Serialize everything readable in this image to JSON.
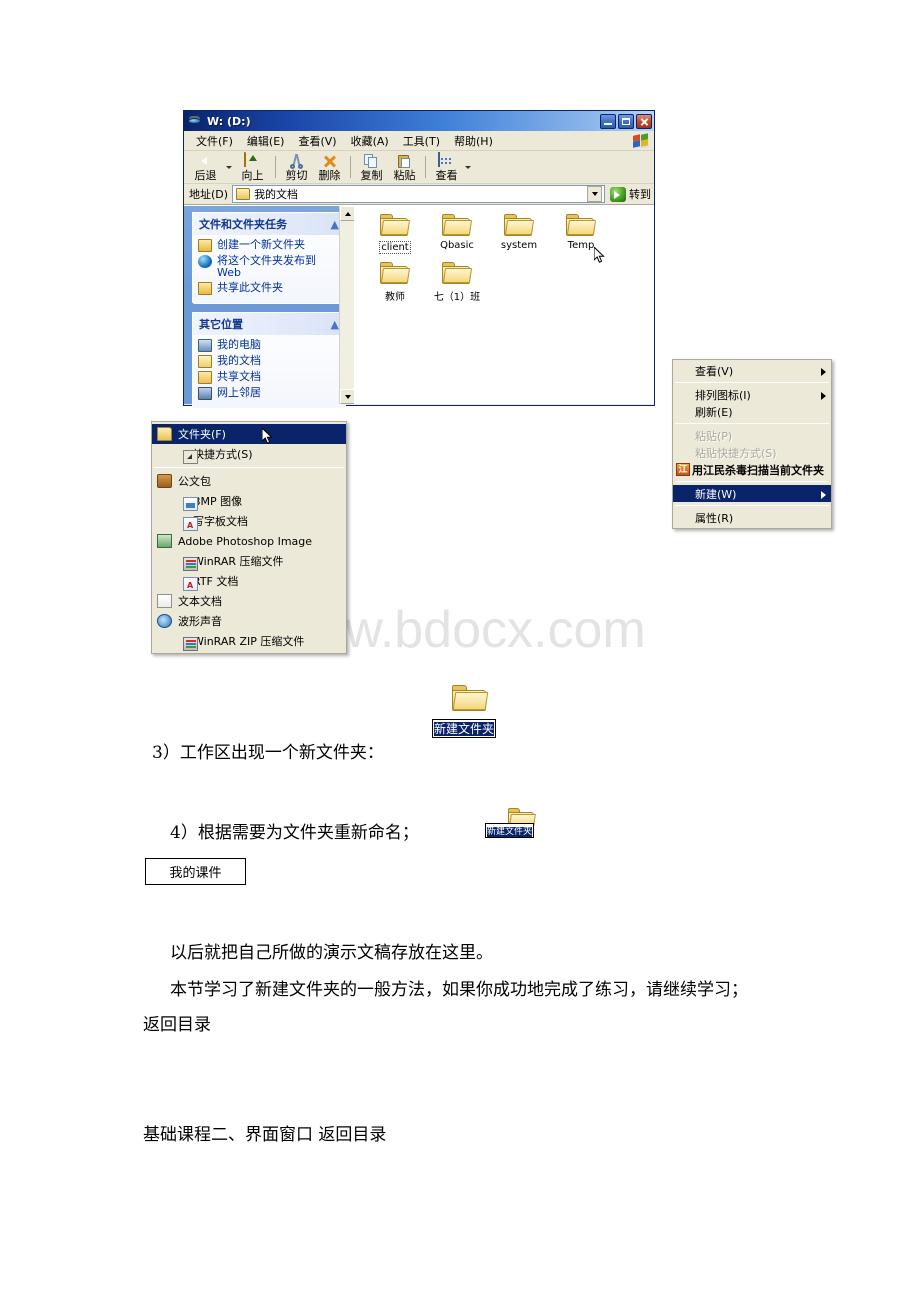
{
  "watermark": "www.bdocx.com",
  "explorer": {
    "title": "W: (D:)",
    "window_buttons": {
      "minimize": "minimize-button",
      "maximize": "maximize-button",
      "close": "close-button"
    },
    "menus": [
      "文件(F)",
      "编辑(E)",
      "查看(V)",
      "收藏(A)",
      "工具(T)",
      "帮助(H)"
    ],
    "toolbar": [
      {
        "label": "后退",
        "icon": "back-icon",
        "has_dropdown": true
      },
      {
        "label": "向上",
        "icon": "up-icon",
        "has_dropdown": false
      },
      {
        "label": "剪切",
        "icon": "cut-icon",
        "has_dropdown": false
      },
      {
        "label": "删除",
        "icon": "delete-icon",
        "has_dropdown": false
      },
      {
        "label": "复制",
        "icon": "copy-icon",
        "has_dropdown": false
      },
      {
        "label": "粘贴",
        "icon": "paste-icon",
        "has_dropdown": false
      },
      {
        "label": "查看",
        "icon": "view-icon",
        "has_dropdown": true
      }
    ],
    "address": {
      "label": "地址(D)",
      "value": "我的文档",
      "go_label": "转到"
    },
    "task_panel": {
      "title": "文件和文件夹任务",
      "items": [
        {
          "label": "创建一个新文件夹",
          "icon": "new-folder-icon"
        },
        {
          "label": "将这个文件夹发布到 Web",
          "icon": "publish-web-icon"
        },
        {
          "label": "共享此文件夹",
          "icon": "share-folder-icon"
        }
      ]
    },
    "places_panel": {
      "title": "其它位置",
      "items": [
        {
          "label": "我的电脑",
          "icon": "my-computer-icon"
        },
        {
          "label": "我的文档",
          "icon": "my-documents-icon"
        },
        {
          "label": "共享文档",
          "icon": "shared-documents-icon"
        },
        {
          "label": "网上邻居",
          "icon": "network-places-icon"
        }
      ]
    },
    "files": [
      {
        "name": "client",
        "selected": true
      },
      {
        "name": "Qbasic",
        "selected": false
      },
      {
        "name": "system",
        "selected": false
      },
      {
        "name": "Temp",
        "selected": false
      },
      {
        "name": "教师",
        "selected": false
      },
      {
        "name": "七（1）班",
        "selected": false
      }
    ]
  },
  "context_menu": {
    "items": [
      {
        "label": "查看(V)",
        "submenu": true,
        "disabled": false,
        "highlighted": false,
        "bold": false,
        "separator_after": true
      },
      {
        "label": "排列图标(I)",
        "submenu": true,
        "disabled": false,
        "highlighted": false,
        "bold": false,
        "separator_after": false
      },
      {
        "label": "刷新(E)",
        "submenu": false,
        "disabled": false,
        "highlighted": false,
        "bold": false,
        "separator_after": true
      },
      {
        "label": "粘贴(P)",
        "submenu": false,
        "disabled": true,
        "highlighted": false,
        "bold": false,
        "separator_after": false
      },
      {
        "label": "粘贴快捷方式(S)",
        "submenu": false,
        "disabled": true,
        "highlighted": false,
        "bold": false,
        "separator_after": false
      },
      {
        "label": "用江民杀毒扫描当前文件夹",
        "submenu": false,
        "disabled": false,
        "highlighted": false,
        "bold": true,
        "separator_after": true
      },
      {
        "label": "新建(W)",
        "submenu": true,
        "disabled": false,
        "highlighted": true,
        "bold": false,
        "separator_after": true
      },
      {
        "label": "属性(R)",
        "submenu": false,
        "disabled": false,
        "highlighted": false,
        "bold": false,
        "separator_after": false
      }
    ]
  },
  "submenu": {
    "items": [
      {
        "label": "文件夹(F)",
        "icon": "folder-icon",
        "highlighted": true,
        "separator_after": false
      },
      {
        "label": "快捷方式(S)",
        "icon": "shortcut-icon",
        "highlighted": false,
        "separator_after": true
      },
      {
        "label": "公文包",
        "icon": "briefcase-icon",
        "highlighted": false,
        "separator_after": false
      },
      {
        "label": "BMP 图像",
        "icon": "bmp-image-icon",
        "highlighted": false,
        "separator_after": false
      },
      {
        "label": "写字板文档",
        "icon": "wordpad-icon",
        "highlighted": false,
        "separator_after": false
      },
      {
        "label": "Adobe Photoshop Image",
        "icon": "photoshop-icon",
        "highlighted": false,
        "separator_after": false
      },
      {
        "label": "WinRAR 压缩文件",
        "icon": "winrar-icon",
        "highlighted": false,
        "separator_after": false
      },
      {
        "label": "RTF 文档",
        "icon": "rtf-icon",
        "highlighted": false,
        "separator_after": false
      },
      {
        "label": "文本文档",
        "icon": "text-file-icon",
        "highlighted": false,
        "separator_after": false
      },
      {
        "label": "波形声音",
        "icon": "wave-sound-icon",
        "highlighted": false,
        "separator_after": false
      },
      {
        "label": "WinRAR ZIP 压缩文件",
        "icon": "winrar-zip-icon",
        "highlighted": false,
        "separator_after": false
      }
    ]
  },
  "document": {
    "step3": "3）工作区出现一个新文件夹：",
    "step3_folder_name": "新建文件夹",
    "step4": "4）根据需要为文件夹重新命名；",
    "step4_folder_name": "新建文件夹",
    "renamed_label": "我的课件",
    "para1": "以后就把自己所做的演示文稿存放在这里。",
    "para2": "本节学习了新建文件夹的一般方法，如果你成功地完成了练习，请继续学习；",
    "para3": "返回目录",
    "para4": "基础课程二、界面窗口  返回目录"
  }
}
